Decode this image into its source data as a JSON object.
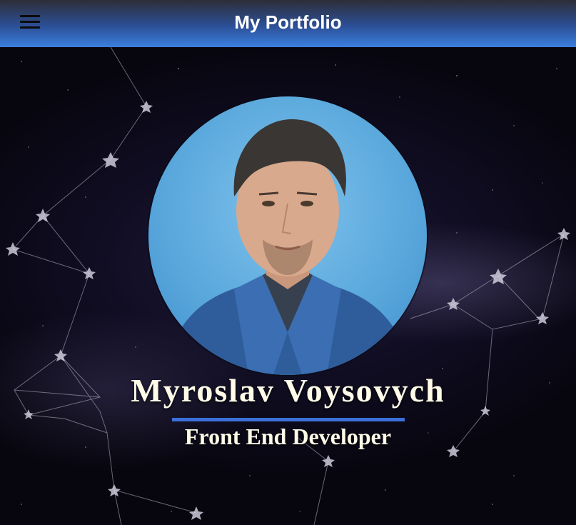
{
  "header": {
    "title": "My Portfolio",
    "menu_icon": "hamburger-menu-icon"
  },
  "hero": {
    "background": "starry-night-constellations",
    "avatar": "profile-photo",
    "name": "Myroslav Voysovych",
    "role": "Front End Developer"
  },
  "colors": {
    "header_top": "#2e2e38",
    "header_bottom": "#3a7fe0",
    "accent": "#3c6fd8",
    "text": "#fffbe8",
    "sky": "#100d22"
  }
}
